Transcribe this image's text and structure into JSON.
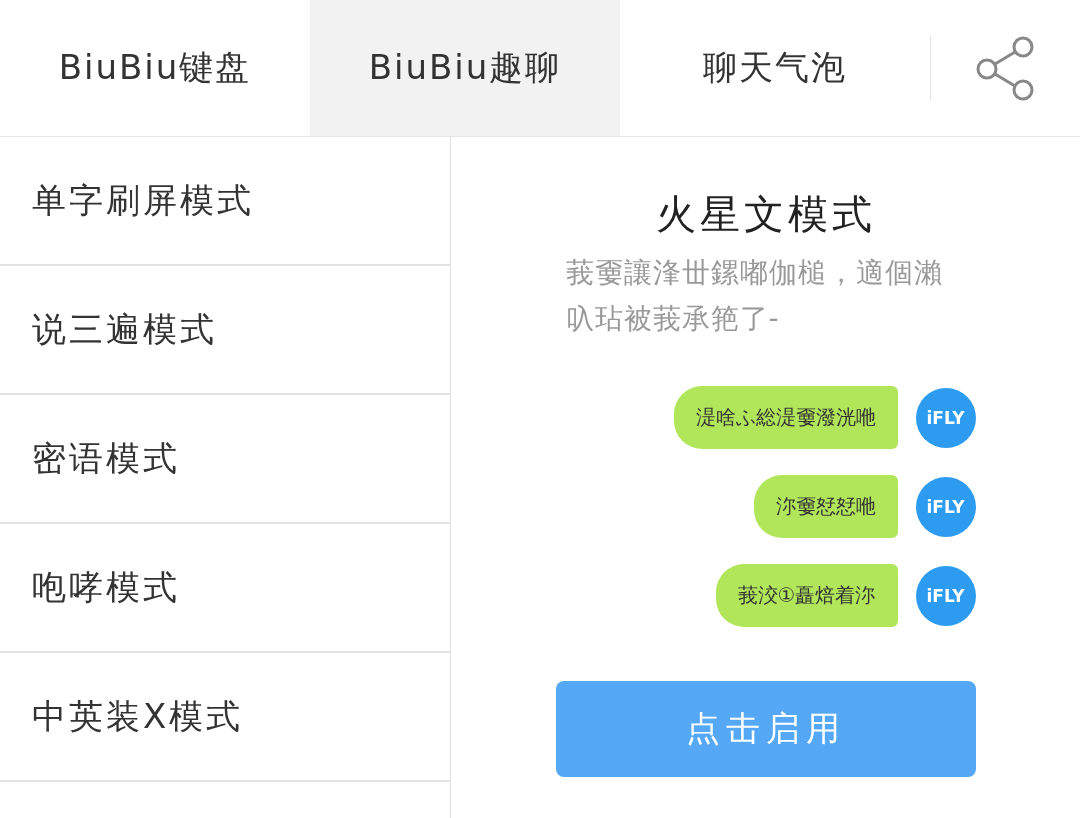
{
  "tabs": [
    {
      "label": "BiuBiu键盘",
      "selected": false
    },
    {
      "label": "BiuBiu趣聊",
      "selected": true
    },
    {
      "label": "聊天气泡",
      "selected": false
    }
  ],
  "modes": [
    {
      "label": "单字刷屏模式"
    },
    {
      "label": "说三遍模式"
    },
    {
      "label": "密语模式"
    },
    {
      "label": "咆哮模式"
    },
    {
      "label": "中英装X模式"
    }
  ],
  "preview": {
    "title": "火星文模式",
    "description": "莪嫑讓浲丗鏍嘟伽槌，適個瀨叺玷被莪承筢了-",
    "messages": [
      {
        "text": "湜啥ふ総湜嫑潑洸咃",
        "avatar": "iFLY"
      },
      {
        "text": "沵嫑恏恏咃",
        "avatar": "iFLY"
      },
      {
        "text": "莪洨①矗焙着沵",
        "avatar": "iFLY"
      }
    ],
    "button": "点击启用"
  }
}
